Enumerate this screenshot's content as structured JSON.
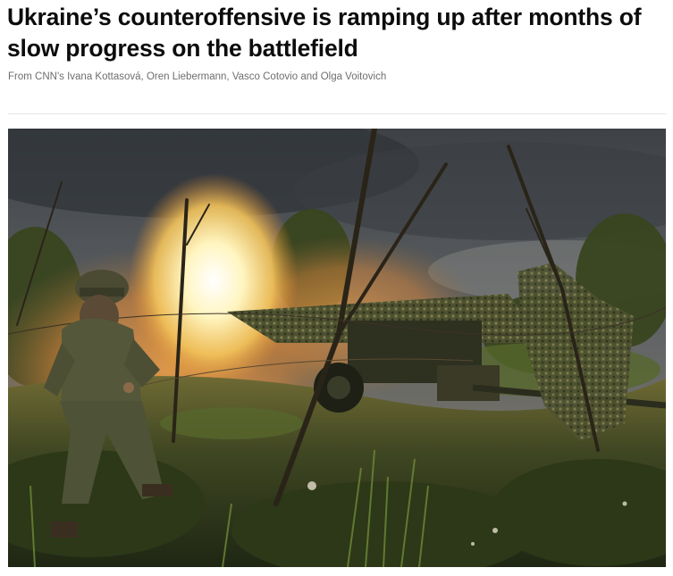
{
  "article": {
    "headline": "Ukraine’s counteroffensive is ramping up after months of slow progress on the battlefield",
    "byline": "From CNN's Ivana Kottasová, Oren Liebermann, Vasco Cotovio and Olga Voitovich"
  },
  "photo": {
    "subject": "soldier firing artillery gun under camouflage netting in a field",
    "colors": {
      "sky": "#4a4e52",
      "flash": "#fff6c8",
      "smoke": "#d38a3e",
      "grass": "#3f4a26"
    }
  }
}
